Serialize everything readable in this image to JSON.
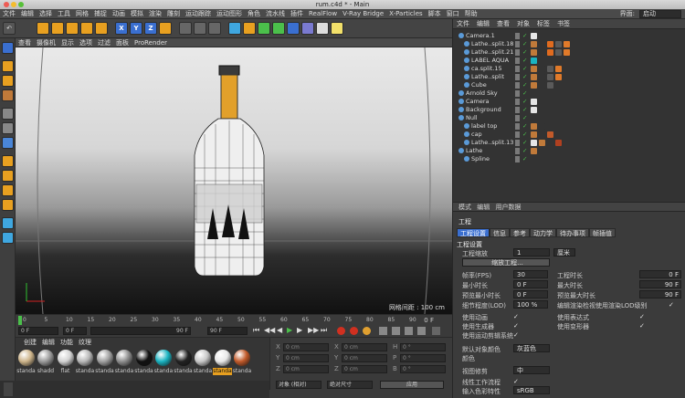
{
  "window": {
    "title": "rum.c4d * - Main"
  },
  "menubar": [
    "文件",
    "编辑",
    "选择",
    "工具",
    "网格",
    "捕捉",
    "动画",
    "模拟",
    "渲染",
    "雕刻",
    "运动跟踪",
    "运动图形",
    "角色",
    "流水线",
    "插件",
    "RealFlow",
    "V-Ray Bridge",
    "X-Particles",
    "脚本",
    "窗口",
    "帮助"
  ],
  "layout": {
    "label": "界面:",
    "value": "启动"
  },
  "viewport": {
    "menu": [
      "查看",
      "摄像机",
      "显示",
      "选项",
      "过滤",
      "面板",
      "ProRender"
    ],
    "grid_info": "网格间距 : 100 cm"
  },
  "timeline": {
    "ticks": [
      "0",
      "5",
      "10",
      "15",
      "20",
      "25",
      "30",
      "35",
      "40",
      "45",
      "50",
      "55",
      "60",
      "65",
      "70",
      "75",
      "80",
      "85",
      "90"
    ],
    "end_label": "0 F",
    "fields": {
      "start": "0 F",
      "current": "0 F",
      "range_end": "90 F",
      "end": "90 F"
    }
  },
  "materials": {
    "menu": [
      "创建",
      "编辑",
      "功能",
      "纹理"
    ],
    "items": [
      {
        "label": "standa",
        "color": "#cdb48a"
      },
      {
        "label": "shadd",
        "color": "#9a9a9a"
      },
      {
        "label": "flat",
        "color": "#d2d2d2"
      },
      {
        "label": "standa",
        "color": "#b8b8b8"
      },
      {
        "label": "standa",
        "color": "#a0a0a0"
      },
      {
        "label": "standa",
        "color": "#8e8e8e"
      },
      {
        "label": "standa",
        "color": "#111111"
      },
      {
        "label": "standa",
        "color": "#1ab3c1"
      },
      {
        "label": "standa",
        "color": "#222222"
      },
      {
        "label": "standa",
        "color": "#c8c8c8"
      },
      {
        "label": "standa",
        "color": "#e8e8e8"
      },
      {
        "label": "standa",
        "color": "#c25a2a"
      }
    ],
    "selected_index": 10
  },
  "coords": {
    "rows": [
      {
        "a": "X",
        "v1": "0 cm",
        "b": "X",
        "v2": "0 cm",
        "c": "H",
        "v3": "0 °"
      },
      {
        "a": "Y",
        "v1": "0 cm",
        "b": "Y",
        "v2": "0 cm",
        "c": "P",
        "v3": "0 °"
      },
      {
        "a": "Z",
        "v1": "0 cm",
        "b": "Z",
        "v2": "0 cm",
        "c": "B",
        "v3": "0 °"
      }
    ],
    "mode": "对象 (相对)",
    "size_mode": "绝对尺寸",
    "apply": "应用"
  },
  "objects": {
    "tabs": [
      "文件",
      "编辑",
      "查看",
      "对象",
      "标签",
      "书签"
    ],
    "rows": [
      {
        "name": "Camera.1",
        "indent": 0,
        "tags": [
          "#e6e6e6"
        ]
      },
      {
        "name": "Lathe..split.18",
        "indent": 1,
        "tags": [
          "#c07a3a",
          "#333",
          "#e06b1f",
          "#5a5a5a",
          "#e07a2a"
        ]
      },
      {
        "name": "Lathe..split.21",
        "indent": 1,
        "tags": [
          "#c07a3a",
          "#333",
          "#e06b1f",
          "#5a5a5a",
          "#e07a2a"
        ]
      },
      {
        "name": "LABEL AQUA",
        "indent": 1,
        "tags": [
          "#1ab3c1"
        ]
      },
      {
        "name": "ca.split.15",
        "indent": 1,
        "tags": [
          "#c07a3a",
          "#333",
          "#5a5a5a",
          "#e07a2a"
        ]
      },
      {
        "name": "Lathe..split",
        "indent": 1,
        "tags": [
          "#c07a3a",
          "#333",
          "#5a5a5a",
          "#e07a2a"
        ]
      },
      {
        "name": "Cube",
        "indent": 1,
        "tags": [
          "#c07a3a",
          "#333",
          "#5a5a5a"
        ]
      },
      {
        "name": "Arnold Sky",
        "indent": 0,
        "tags": []
      },
      {
        "name": "Camera",
        "indent": 0,
        "tags": [
          "#e6e6e6"
        ]
      },
      {
        "name": "Background",
        "indent": 0,
        "tags": [
          "#e6e6e6"
        ]
      },
      {
        "name": "Null",
        "indent": 0,
        "tags": []
      },
      {
        "name": "label top",
        "indent": 1,
        "tags": [
          "#c07a3a",
          "#333"
        ]
      },
      {
        "name": "cap",
        "indent": 1,
        "tags": [
          "#c07a3a",
          "#333",
          "#c25a2a"
        ]
      },
      {
        "name": "Lathe..split.13",
        "indent": 1,
        "tags": [
          "#e6e6e6",
          "#c07a3a",
          "#333",
          "#b04020"
        ]
      },
      {
        "name": "Lathe",
        "indent": 0,
        "tags": [
          "#c07a3a"
        ]
      },
      {
        "name": "Spline",
        "indent": 1,
        "tags": []
      }
    ]
  },
  "attributes": {
    "menu": [
      "模式",
      "编辑",
      "用户数据"
    ],
    "title": "工程",
    "tabs": [
      "工程设置",
      "信息",
      "参考",
      "动力学",
      "待办事项",
      "帧插值"
    ],
    "section": "工程设置",
    "scale_label": "工程缩放",
    "scale_value": "1",
    "scale_unit": "厘米",
    "scale_button": "缩放工程...",
    "left_rows": [
      {
        "label": "帧率(FPS)",
        "value": "30"
      },
      {
        "label": "最小时长",
        "value": "0 F"
      },
      {
        "label": "预览最小时长",
        "value": "0 F"
      },
      {
        "label": "细节程度(LOD)",
        "value": "100 %"
      }
    ],
    "right_rows": [
      {
        "label": "工程时长",
        "value": "0 F"
      },
      {
        "label": "最大时长",
        "value": "90 F"
      },
      {
        "label": "预览最大时长",
        "value": "90 F"
      },
      {
        "label": "编辑渲染检视使用渲染LOD级别",
        "value": ""
      }
    ],
    "checks_left": [
      "使用动画",
      "使用生成器",
      "使用运动剪辑系统"
    ],
    "checks_right": [
      "使用表达式",
      "使用变形器"
    ],
    "default_color_label": "默认对象颜色",
    "default_color_value": "灰蓝色",
    "color_label": "颜色",
    "view_clip_label": "视图修剪",
    "view_clip_value": "中",
    "linear_label": "线性工作流程",
    "input_color_label": "输入色彩特性",
    "input_color_value": "sRGB"
  }
}
